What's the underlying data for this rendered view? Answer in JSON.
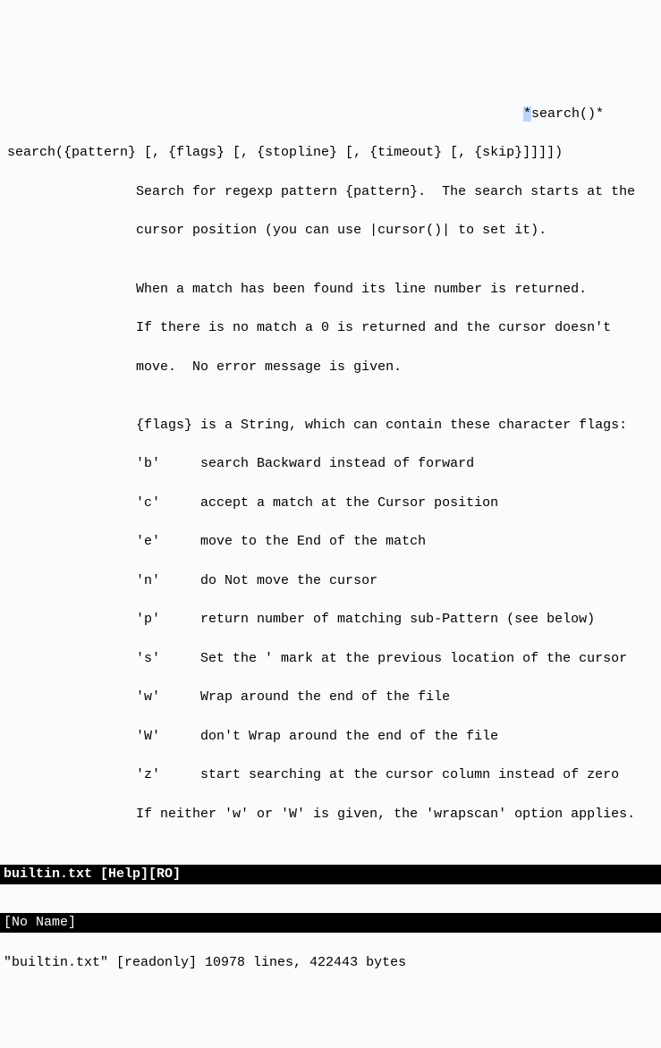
{
  "tag": {
    "star_left": "*",
    "label": "search()",
    "star_right": "*"
  },
  "signature": "search({pattern} [, {flags} [, {stopline} [, {timeout} [, {skip}]]]])",
  "desc": [
    "                Search for regexp pattern {pattern}.  The search starts at the",
    "                cursor position (you can use |cursor()| to set it).",
    "",
    "                When a match has been found its line number is returned.",
    "                If there is no match a 0 is returned and the cursor doesn't",
    "                move.  No error message is given.",
    "",
    "                {flags} is a String, which can contain these character flags:",
    "                'b'     search Backward instead of forward",
    "                'c'     accept a match at the Cursor position",
    "                'e'     move to the End of the match",
    "                'n'     do Not move the cursor",
    "                'p'     return number of matching sub-Pattern (see below)",
    "                's'     Set the ' mark at the previous location of the cursor",
    "                'w'     Wrap around the end of the file",
    "                'W'     don't Wrap around the end of the file",
    "                'z'     start searching at the cursor column instead of zero",
    "                If neither 'w' or 'W' is given, the 'wrapscan' option applies."
  ],
  "status_help": "builtin.txt [Help][RO]",
  "status_empty": "[No Name]",
  "cmdline": "\"builtin.txt\" [readonly] 10978 lines, 422443 bytes"
}
